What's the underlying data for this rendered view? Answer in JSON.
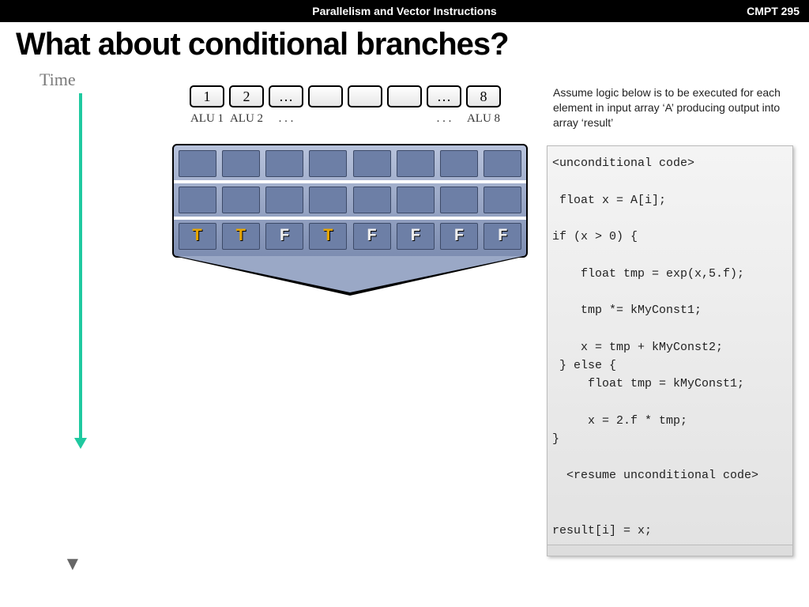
{
  "header": {
    "center": "Parallelism and Vector Instructions",
    "right": "CMPT 295"
  },
  "title": "What about  conditional branches?",
  "time_label": "Time",
  "alu_boxes": [
    "1",
    "2",
    "…",
    "",
    "",
    "",
    "…",
    "8"
  ],
  "alu_labels": [
    "ALU 1",
    "ALU 2",
    ". . .",
    "",
    "",
    "",
    ". . .",
    "ALU 8"
  ],
  "tf_row": [
    "T",
    "T",
    "F",
    "T",
    "F",
    "F",
    "F",
    "F"
  ],
  "description": "Assume logic below is to be executed for each element in input array ‘A’ producing output into array ‘result’",
  "code": {
    "l1": "<unconditional code>",
    "l2": " float x = A[i];",
    "l3": "if (x > 0) {",
    "l4": "    float tmp = exp(x,5.f);",
    "l5": "    tmp *= kMyConst1;",
    "l6": "    x = tmp + kMyConst2;",
    "l7": " } else {",
    "l8": "     float tmp = kMyConst1;",
    "l9": "     x = 2.f * tmp;",
    "l10": "}",
    "l11": "  <resume unconditional code>",
    "l12": "result[i] = x;"
  }
}
